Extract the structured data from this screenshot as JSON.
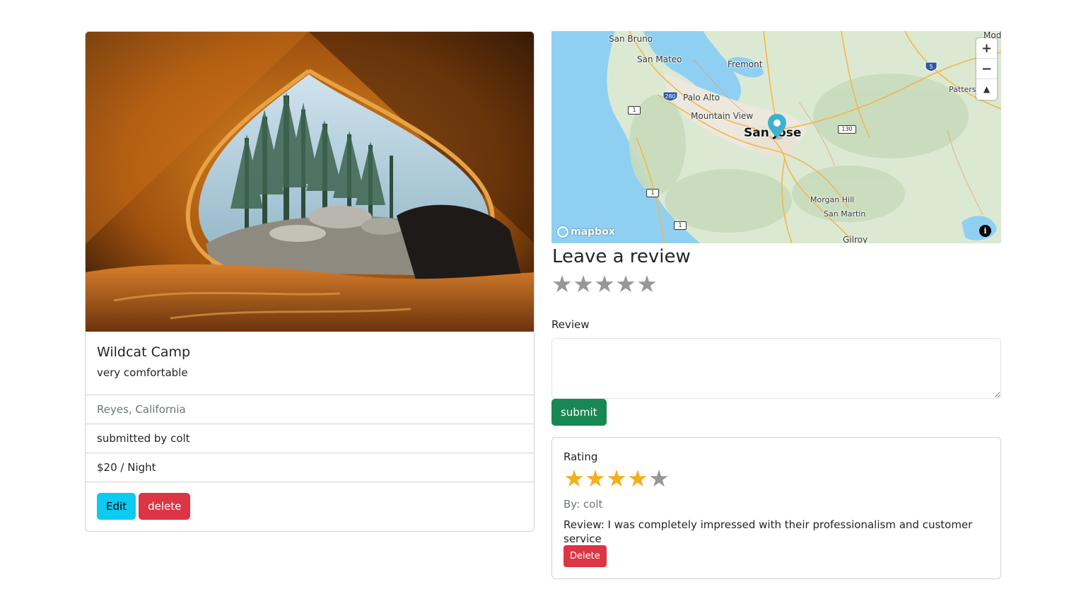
{
  "campground": {
    "title": "Wildcat Camp",
    "description": "very comfortable",
    "location": "Reyes, California",
    "submitted_by": "submitted by colt",
    "price": "$20 / Night",
    "edit_label": "Edit",
    "delete_label": "delete"
  },
  "map": {
    "labels": {
      "san_bruno": "San Bruno",
      "san_mateo": "San Mateo",
      "fremont": "Fremont",
      "palo_alto": "Palo Alto",
      "mountain_view": "Mountain View",
      "san_jose": "San Jose",
      "morgan_hill": "Morgan Hill",
      "san_martin": "San Martin",
      "gilroy": "Gilroy",
      "modesto_partial": "Mod",
      "patterson_partial": "Patters"
    },
    "road_shields": {
      "i280": "280",
      "i5": "5",
      "r1a": "1",
      "r1b": "1",
      "r1c": "1",
      "r130": "130"
    },
    "zoom_in": "+",
    "zoom_out": "−",
    "compass": "▲",
    "attribution_logo": "mapbox",
    "info": "i",
    "pin_color": "#3fb1ce"
  },
  "review_form": {
    "heading": "Leave a review",
    "rating_stars": [
      "★",
      "★",
      "★",
      "★",
      "★"
    ],
    "rating_value": 0,
    "review_label": "Review",
    "review_text": "",
    "submit_label": "submit"
  },
  "reviews": [
    {
      "title": "Rating",
      "rating": 4,
      "max_rating": 5,
      "stars": [
        "★",
        "★",
        "★",
        "★",
        "★"
      ],
      "author": "By: colt",
      "text": "Review: I was completely impressed with their professionalism and customer service",
      "delete_label": "Delete"
    }
  ],
  "colors": {
    "star_filled": "#f2b01e",
    "star_empty": "#979797",
    "edit_button": "#0dcaf0",
    "delete_button": "#dc3545",
    "submit_button": "#198754"
  }
}
